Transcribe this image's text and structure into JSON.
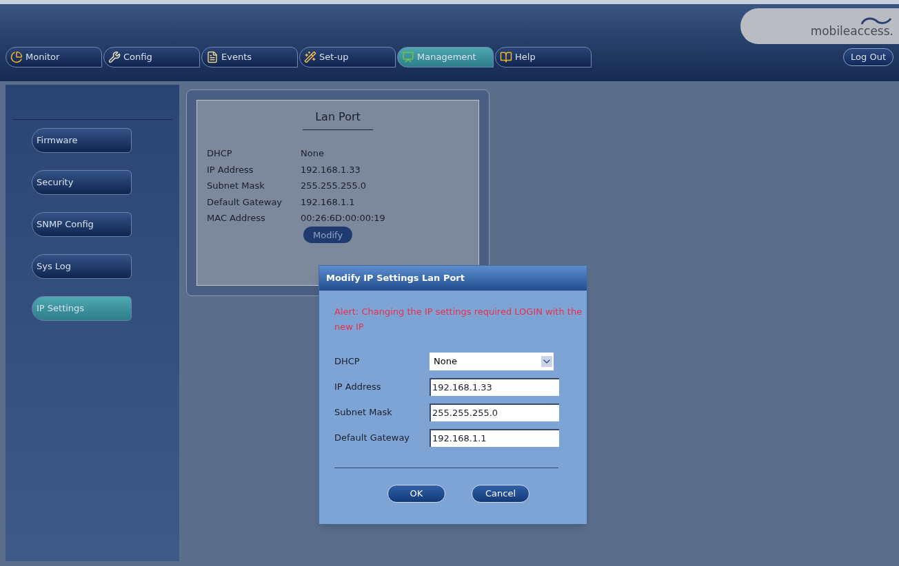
{
  "header": {
    "logo": "mobileaccess.",
    "logout": "Log Out"
  },
  "tabs": [
    {
      "label": "Monitor",
      "selected": false
    },
    {
      "label": "Config",
      "selected": false
    },
    {
      "label": "Events",
      "selected": false
    },
    {
      "label": "Set-up",
      "selected": false
    },
    {
      "label": "Management",
      "selected": true
    },
    {
      "label": "Help",
      "selected": false
    }
  ],
  "sidebar": {
    "items": [
      {
        "label": "Firmware",
        "selected": false
      },
      {
        "label": "Security",
        "selected": false
      },
      {
        "label": "SNMP Config",
        "selected": false
      },
      {
        "label": "Sys Log",
        "selected": false
      },
      {
        "label": "IP Settings",
        "selected": true
      }
    ]
  },
  "lan_panel": {
    "title": "Lan Port",
    "rows": [
      {
        "label": "DHCP",
        "value": "None"
      },
      {
        "label": "IP Address",
        "value": "192.168.1.33"
      },
      {
        "label": "Subnet Mask",
        "value": "255.255.255.0"
      },
      {
        "label": "Default Gateway",
        "value": "192.168.1.1"
      },
      {
        "label": "MAC Address",
        "value": "00:26:6D:00:00:19"
      }
    ],
    "button": "Modify"
  },
  "dialog": {
    "title": "Modify IP Settings Lan Port",
    "alert": "Alert: Changing the IP settings required LOGIN with the new IP",
    "fields": [
      {
        "kind": "select",
        "label": "DHCP",
        "value": "None"
      },
      {
        "kind": "text",
        "label": "IP Address",
        "value": "192.168.1.33"
      },
      {
        "kind": "text",
        "label": "Subnet Mask",
        "value": "255.255.255.0"
      },
      {
        "kind": "text",
        "label": "Default Gateway",
        "value": "192.168.1.1"
      }
    ],
    "buttons": [
      "OK",
      "Cancel"
    ]
  }
}
